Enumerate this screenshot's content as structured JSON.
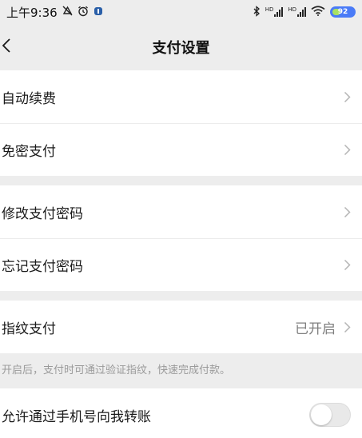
{
  "status_bar": {
    "time": "上午9:36",
    "battery": "92"
  },
  "nav": {
    "title": "支付设置"
  },
  "groups": [
    {
      "items": [
        {
          "label": "自动续费"
        },
        {
          "label": "免密支付"
        }
      ]
    },
    {
      "items": [
        {
          "label": "修改支付密码"
        },
        {
          "label": "忘记支付密码"
        }
      ]
    },
    {
      "items": [
        {
          "label": "指纹支付",
          "value": "已开启"
        }
      ]
    }
  ],
  "fingerprint_hint": "开启后，支付时可通过验证指纹，快速完成付款。",
  "phone_transfer": {
    "label": "允许通过手机号向我转账",
    "enabled": false
  },
  "icons": {
    "back": "back-arrow-icon",
    "chevron": "chevron-right-icon",
    "bluetooth": "bluetooth-icon",
    "wifi": "wifi-icon",
    "alarm": "alarm-icon",
    "mute": "mute-icon"
  }
}
